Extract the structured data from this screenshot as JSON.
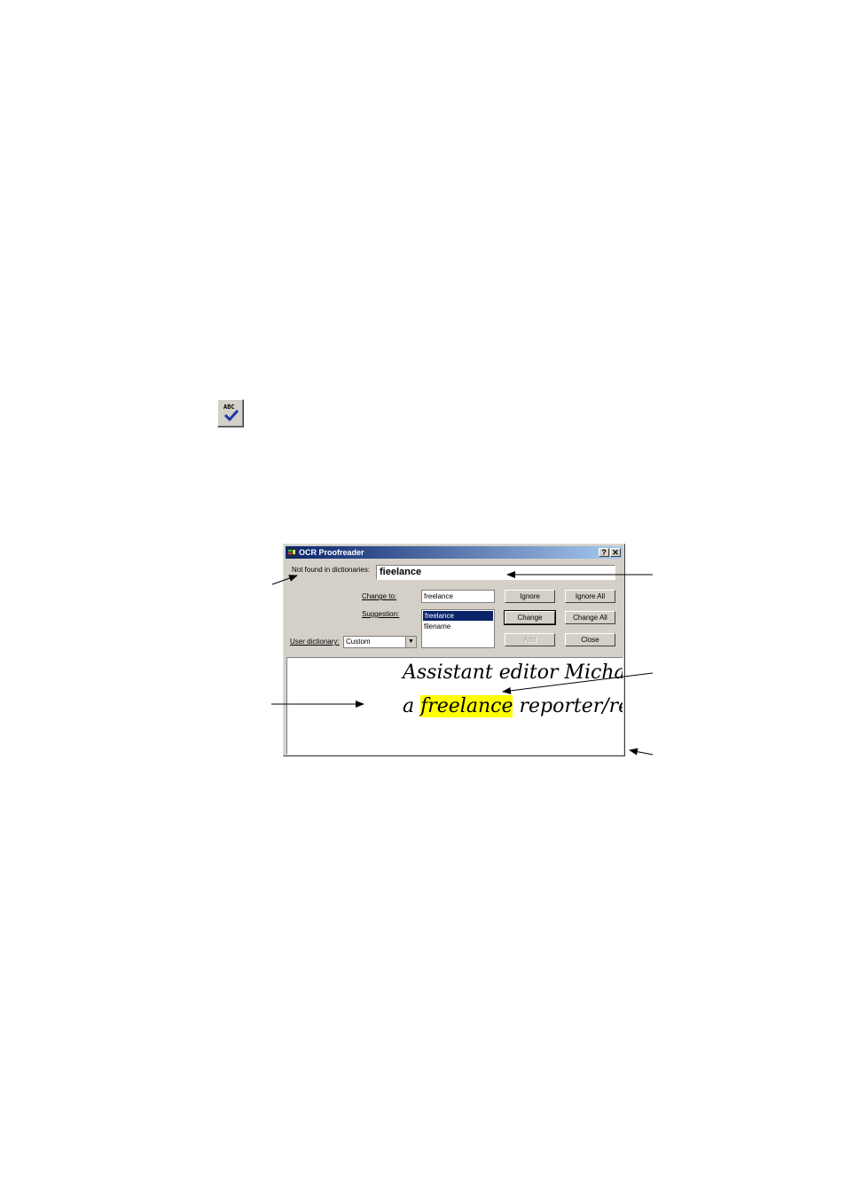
{
  "toolbar_icon": {
    "icon": "spellcheck-abc-icon",
    "text": "ABC"
  },
  "dialog": {
    "title": "OCR Proofreader",
    "help_btn": "?",
    "close_btn": "✕",
    "not_found_label": "Not found in dictionaries:",
    "not_found_value": "fieelance",
    "change_to_label": "Change to:",
    "change_to_value": "freelance",
    "suggestion_label": "Suggestion:",
    "suggestions": [
      "freelance",
      "filename"
    ],
    "user_dictionary_label": "User dictionary:",
    "user_dictionary_value": "Custom",
    "buttons": {
      "ignore": "Ignore",
      "ignore_all": "Ignore All",
      "change": "Change",
      "change_all": "Change All",
      "add": "Add",
      "close": "Close"
    },
    "preview": {
      "line1": "Assistant editor Michael .",
      "line2_prefix": "a ",
      "line2_highlight": "freelance",
      "line2_suffix": " reporter/resear"
    }
  }
}
